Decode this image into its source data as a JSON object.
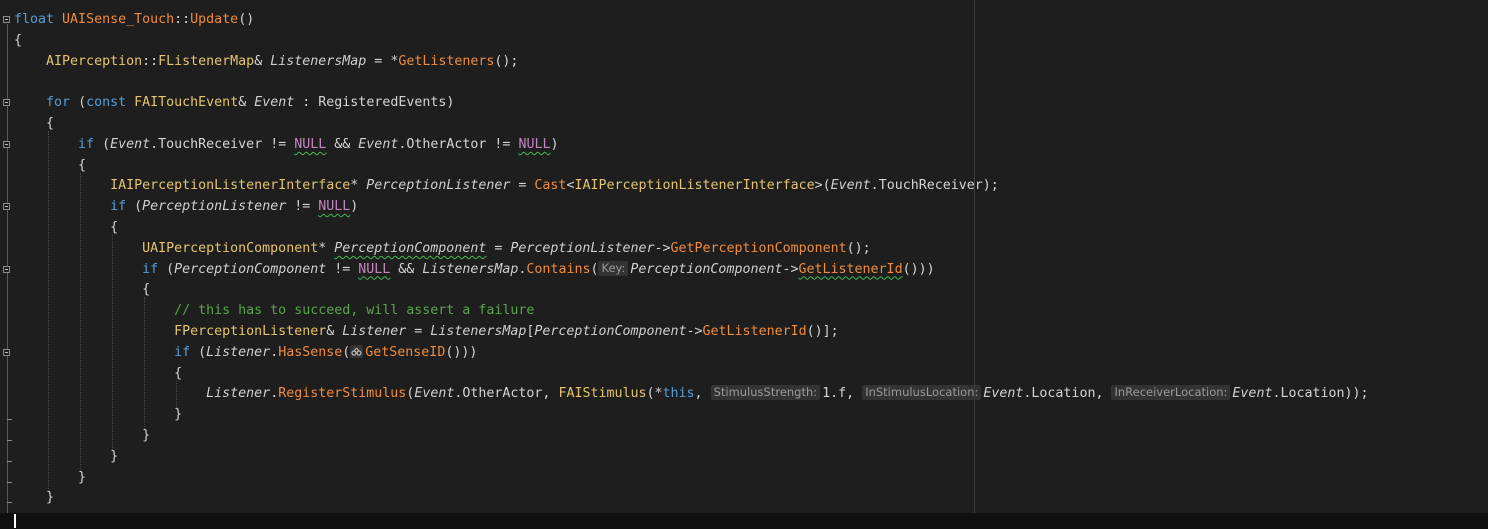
{
  "lines": [
    [
      {
        "t": "float",
        "c": "kw"
      },
      {
        "t": " "
      },
      {
        "t": "UAISense_Touch",
        "c": "fn"
      },
      {
        "t": "::",
        "c": "ns"
      },
      {
        "t": "Update",
        "c": "fn"
      },
      {
        "t": "()"
      }
    ],
    [
      {
        "t": "{"
      }
    ],
    [
      {
        "t": "    "
      },
      {
        "t": "AIPerception",
        "c": "ty"
      },
      {
        "t": "::",
        "c": "ns"
      },
      {
        "t": "FListenerMap",
        "c": "ty"
      },
      {
        "t": "& "
      },
      {
        "t": "ListenersMap",
        "c": "par"
      },
      {
        "t": " = *"
      },
      {
        "t": "GetListeners",
        "c": "fn"
      },
      {
        "t": "();"
      }
    ],
    [
      {
        "t": ""
      }
    ],
    [
      {
        "t": "    "
      },
      {
        "t": "for",
        "c": "kw"
      },
      {
        "t": " ("
      },
      {
        "t": "const",
        "c": "kw"
      },
      {
        "t": " "
      },
      {
        "t": "FAITouchEvent",
        "c": "ty"
      },
      {
        "t": "& "
      },
      {
        "t": "Event",
        "c": "par"
      },
      {
        "t": " : "
      },
      {
        "t": "RegisteredEvents",
        "c": "mem"
      },
      {
        "t": ")"
      }
    ],
    [
      {
        "t": "    {"
      }
    ],
    [
      {
        "t": "        "
      },
      {
        "t": "if",
        "c": "kw"
      },
      {
        "t": " ("
      },
      {
        "t": "Event",
        "c": "par"
      },
      {
        "t": "."
      },
      {
        "t": "TouchReceiver",
        "c": "mem"
      },
      {
        "t": " != "
      },
      {
        "t": "NULL",
        "c": "mac sq"
      },
      {
        "t": " && "
      },
      {
        "t": "Event",
        "c": "par"
      },
      {
        "t": "."
      },
      {
        "t": "OtherActor",
        "c": "mem"
      },
      {
        "t": " != "
      },
      {
        "t": "NULL",
        "c": "mac sq"
      },
      {
        "t": ")"
      }
    ],
    [
      {
        "t": "        {"
      }
    ],
    [
      {
        "t": "            "
      },
      {
        "t": "IAIPerceptionListenerInterface",
        "c": "ty"
      },
      {
        "t": "* "
      },
      {
        "t": "PerceptionListener",
        "c": "par"
      },
      {
        "t": " = "
      },
      {
        "t": "Cast",
        "c": "fn"
      },
      {
        "t": "<"
      },
      {
        "t": "IAIPerceptionListenerInterface",
        "c": "ty"
      },
      {
        "t": ">("
      },
      {
        "t": "Event",
        "c": "par"
      },
      {
        "t": "."
      },
      {
        "t": "TouchReceiver",
        "c": "mem"
      },
      {
        "t": ");"
      }
    ],
    [
      {
        "t": "            "
      },
      {
        "t": "if",
        "c": "kw"
      },
      {
        "t": " ("
      },
      {
        "t": "PerceptionListener",
        "c": "par"
      },
      {
        "t": " != "
      },
      {
        "t": "NULL",
        "c": "mac sq"
      },
      {
        "t": ")"
      }
    ],
    [
      {
        "t": "            {"
      }
    ],
    [
      {
        "t": "                "
      },
      {
        "t": "UAIPerceptionComponent",
        "c": "ty"
      },
      {
        "t": "* "
      },
      {
        "t": "PerceptionComponent",
        "c": "par sq"
      },
      {
        "t": " = "
      },
      {
        "t": "PerceptionListener",
        "c": "par"
      },
      {
        "t": "->"
      },
      {
        "t": "GetPerceptionComponent",
        "c": "fn"
      },
      {
        "t": "();"
      }
    ],
    [
      {
        "t": "                "
      },
      {
        "t": "if",
        "c": "kw"
      },
      {
        "t": " ("
      },
      {
        "t": "PerceptionComponent",
        "c": "par"
      },
      {
        "t": " != "
      },
      {
        "t": "NULL",
        "c": "mac sq"
      },
      {
        "t": " && "
      },
      {
        "t": "ListenersMap",
        "c": "par"
      },
      {
        "t": "."
      },
      {
        "t": "Contains",
        "c": "fn"
      },
      {
        "t": "("
      },
      {
        "t": "Key:",
        "c": "hint"
      },
      {
        "t": "PerceptionComponent",
        "c": "par"
      },
      {
        "t": "->"
      },
      {
        "t": "GetListenerId",
        "c": "fn sq"
      },
      {
        "t": "()))"
      }
    ],
    [
      {
        "t": "                {"
      }
    ],
    [
      {
        "t": "                    "
      },
      {
        "t": "// this has to succeed, will assert a failure",
        "c": "cm"
      }
    ],
    [
      {
        "t": "                    "
      },
      {
        "t": "FPerceptionListener",
        "c": "ty"
      },
      {
        "t": "& "
      },
      {
        "t": "Listener",
        "c": "par"
      },
      {
        "t": " = "
      },
      {
        "t": "ListenersMap",
        "c": "par"
      },
      {
        "t": "["
      },
      {
        "t": "PerceptionComponent",
        "c": "par"
      },
      {
        "t": "->"
      },
      {
        "t": "GetListenerId",
        "c": "fn"
      },
      {
        "t": "()];"
      }
    ],
    [
      {
        "t": "                    "
      },
      {
        "t": "if",
        "c": "kw"
      },
      {
        "t": " ("
      },
      {
        "t": "Listener",
        "c": "par"
      },
      {
        "t": "."
      },
      {
        "t": "HasSense",
        "c": "fn"
      },
      {
        "t": "("
      },
      {
        "t": "lens",
        "c": "lens"
      },
      {
        "t": "GetSenseID",
        "c": "fn"
      },
      {
        "t": "()))"
      }
    ],
    [
      {
        "t": "                    {"
      }
    ],
    [
      {
        "t": "                        "
      },
      {
        "t": "Listener",
        "c": "par"
      },
      {
        "t": "."
      },
      {
        "t": "RegisterStimulus",
        "c": "fn"
      },
      {
        "t": "("
      },
      {
        "t": "Event",
        "c": "par"
      },
      {
        "t": "."
      },
      {
        "t": "OtherActor",
        "c": "mem"
      },
      {
        "t": ", "
      },
      {
        "t": "FAIStimulus",
        "c": "ty"
      },
      {
        "t": "(*"
      },
      {
        "t": "this",
        "c": "kw"
      },
      {
        "t": ", "
      },
      {
        "t": "StimulusStrength:",
        "c": "hint"
      },
      {
        "t": "1.f, "
      },
      {
        "t": "InStimulusLocation:",
        "c": "hint"
      },
      {
        "t": "Event",
        "c": "par"
      },
      {
        "t": "."
      },
      {
        "t": "Location",
        "c": "mem"
      },
      {
        "t": ", "
      },
      {
        "t": "InReceiverLocation:",
        "c": "hint"
      },
      {
        "t": "Event",
        "c": "par"
      },
      {
        "t": "."
      },
      {
        "t": "Location",
        "c": "mem"
      },
      {
        "t": "));"
      }
    ],
    [
      {
        "t": "                    }"
      }
    ],
    [
      {
        "t": "                }"
      }
    ],
    [
      {
        "t": "            }"
      }
    ],
    [
      {
        "t": "        }"
      }
    ],
    [
      {
        "t": "    }"
      }
    ]
  ],
  "folds": [
    0,
    4,
    6,
    9,
    12,
    16
  ],
  "fold_ends": [
    19,
    20,
    21,
    22,
    23
  ]
}
